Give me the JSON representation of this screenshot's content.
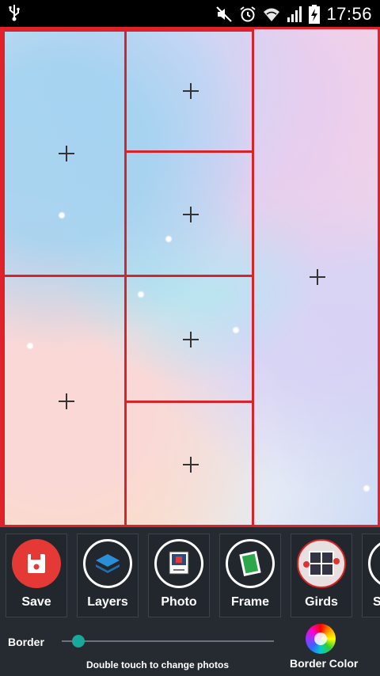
{
  "status_bar": {
    "time": "17:56",
    "icons": [
      "usb-icon",
      "mute-icon",
      "alarm-icon",
      "wifi-icon",
      "signal-icon",
      "battery-charging-icon"
    ]
  },
  "toolbar": {
    "tools": [
      {
        "label": "Save",
        "icon": "save-icon"
      },
      {
        "label": "Layers",
        "icon": "layers-icon"
      },
      {
        "label": "Photo",
        "icon": "photo-icon"
      },
      {
        "label": "Frame",
        "icon": "frame-icon"
      },
      {
        "label": "Girds",
        "icon": "grid-icon"
      },
      {
        "label": "S",
        "icon": "partial-tool-icon"
      }
    ],
    "border_label": "Border",
    "border_value": 0.05,
    "hint": "Double touch to change photos",
    "border_color_label": "Border Color"
  },
  "colors": {
    "frame_border": "#e2222a",
    "save_button": "#e53935",
    "slider_accent": "#1aa89a",
    "toolbar_bg": "#262b31"
  }
}
